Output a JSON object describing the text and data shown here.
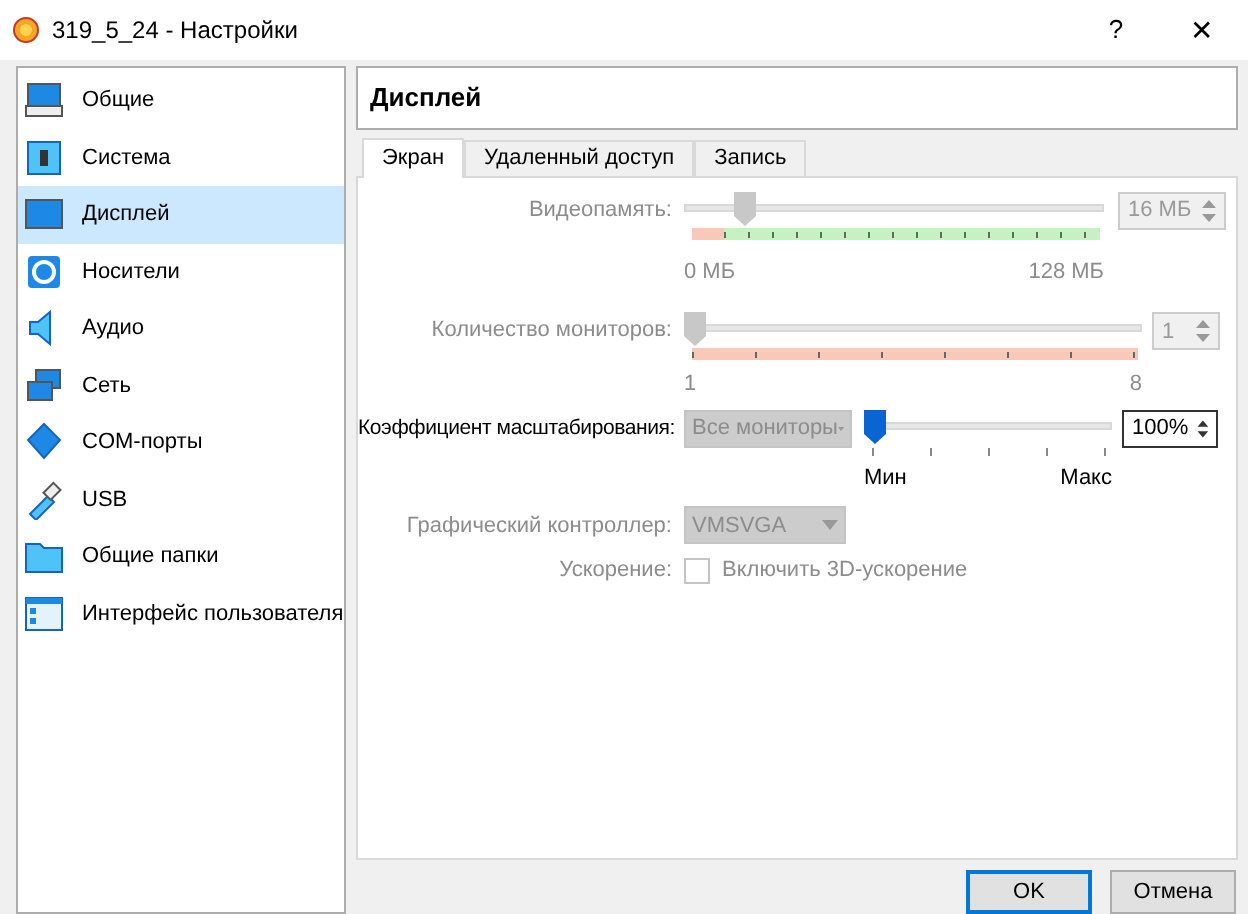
{
  "window": {
    "title": "319_5_24 - Настройки",
    "help": "?",
    "close": "✕"
  },
  "sidebar": {
    "items": [
      {
        "label": "Общие",
        "selected": false
      },
      {
        "label": "Система",
        "selected": false
      },
      {
        "label": "Дисплей",
        "selected": true
      },
      {
        "label": "Носители",
        "selected": false
      },
      {
        "label": "Аудио",
        "selected": false
      },
      {
        "label": "Сеть",
        "selected": false
      },
      {
        "label": "COM-порты",
        "selected": false
      },
      {
        "label": "USB",
        "selected": false
      },
      {
        "label": "Общие папки",
        "selected": false
      },
      {
        "label": "Интерфейс пользователя",
        "selected": false
      }
    ]
  },
  "header": "Дисплей",
  "tabs": [
    {
      "label": "Экран",
      "selected": true
    },
    {
      "label": "Удаленный доступ",
      "selected": false
    },
    {
      "label": "Запись",
      "selected": false
    }
  ],
  "video_memory": {
    "label": "Видеопамять:",
    "level": 0.125,
    "value": "16 МБ",
    "min_label": "0 МБ",
    "max_label": "128 МБ",
    "disabled": true
  },
  "monitors": {
    "label": "Количество мониторов:",
    "level": 0,
    "value": "1",
    "min_label": "1",
    "max_label": "8",
    "disabled": true
  },
  "scale": {
    "label": "Коэффициент масштабирования:",
    "combo": "Все мониторы",
    "combo_disabled": true,
    "level": 0,
    "value": "100%",
    "min_label": "Мин",
    "max_label": "Макс",
    "disabled": false
  },
  "controller": {
    "label": "Графический контроллер:",
    "value": "VMSVGA",
    "disabled": true
  },
  "acceleration": {
    "label": "Ускорение:",
    "checkbox_label": "Включить 3D-ускорение",
    "checked": false,
    "disabled": true
  },
  "buttons": [
    {
      "label": "OK",
      "default": true
    },
    {
      "label": "Отмена",
      "default": false
    }
  ]
}
